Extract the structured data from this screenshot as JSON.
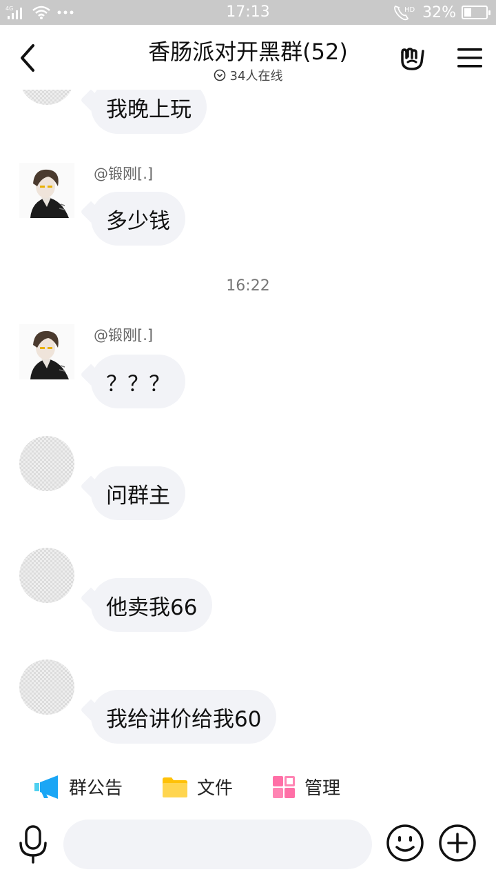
{
  "status_bar": {
    "network": "4G",
    "time": "17:13",
    "call_badge": "HD",
    "battery_text": "32%",
    "battery_level": 0.32
  },
  "header": {
    "title": "香肠派对开黑群(52)",
    "online": "34人在线",
    "icons": [
      "back-arrow-icon",
      "chevron-circle-icon",
      "rock-hand-icon",
      "hamburger-menu-icon"
    ]
  },
  "messages": [
    {
      "sender": "",
      "text": "我晚上玩",
      "avatar": "placeholder"
    },
    {
      "sender": "@锻刚[.]",
      "text": "多少钱",
      "avatar": "photo"
    },
    {
      "timestamp": "16:22"
    },
    {
      "sender": "@锻刚[.]",
      "text": "？？？",
      "avatar": "photo"
    },
    {
      "sender": "",
      "text": "问群主",
      "avatar": "placeholder"
    },
    {
      "sender": "",
      "text": "他卖我66",
      "avatar": "placeholder"
    },
    {
      "sender": "",
      "text": "我给讲价给我60",
      "avatar": "placeholder"
    }
  ],
  "toolbar": {
    "announcement": "群公告",
    "files": "文件",
    "manage": "管理"
  },
  "input_bar": {
    "placeholder": "",
    "icons": [
      "microphone-icon",
      "smiley-icon",
      "plus-icon"
    ]
  },
  "colors": {
    "status_bar_bg": "#c9c9c9",
    "bubble_bg": "#f2f3f7",
    "announcement_icon": "#1ba6f5",
    "folder_icon": "#ffc107",
    "manage_icon": "#ff6fa6"
  }
}
